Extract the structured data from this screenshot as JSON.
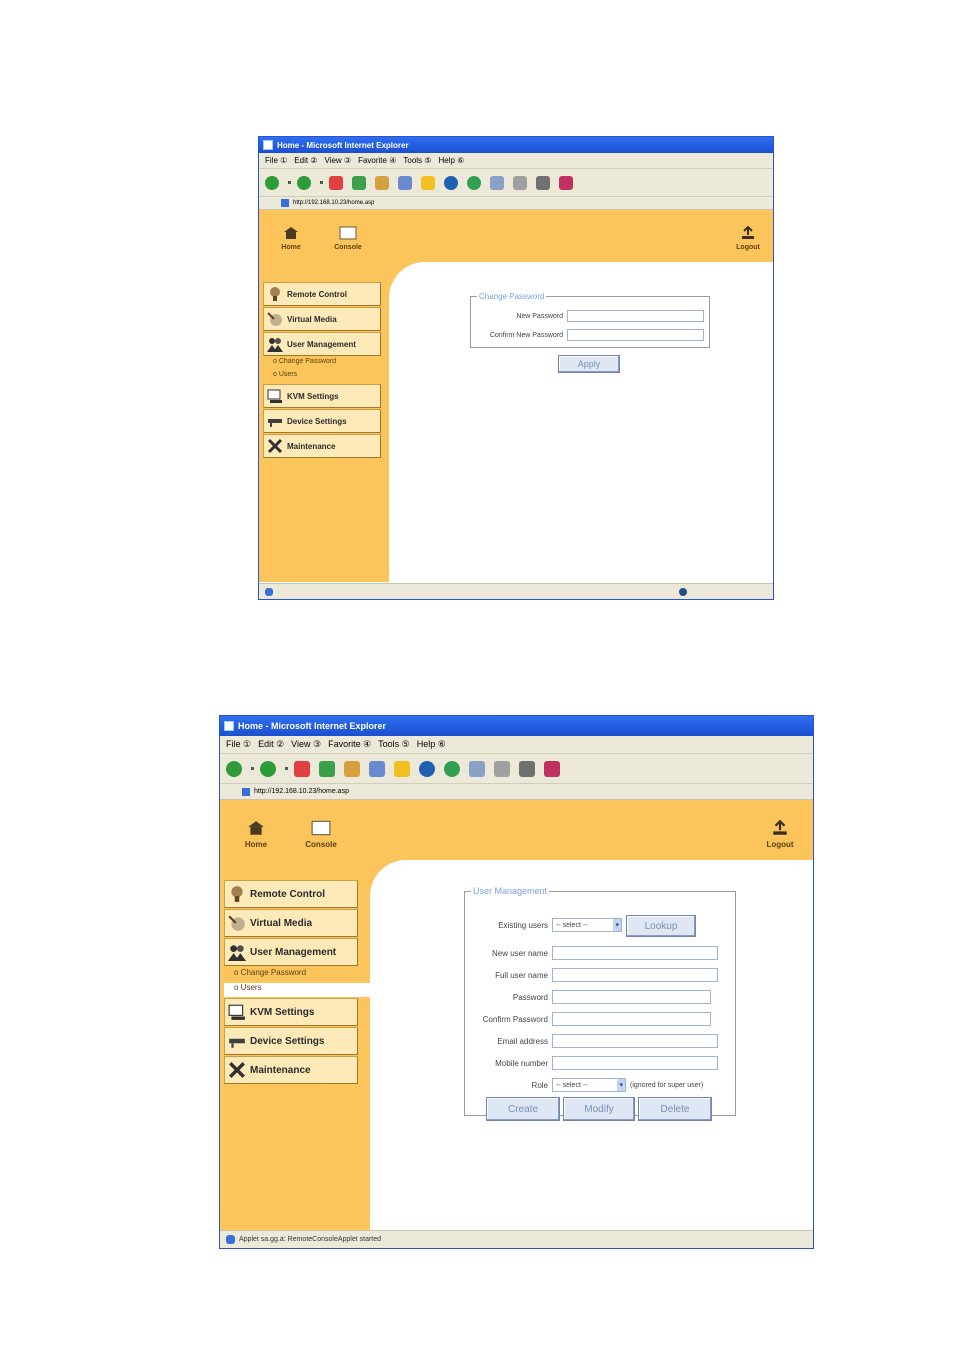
{
  "browser": {
    "title": "Home - Microsoft Internet Explorer",
    "menu": [
      "File ①",
      "Edit ②",
      "View ③",
      "Favorite ④",
      "Tools ⑤",
      "Help ⑥"
    ],
    "address": "http://192.168.10.23/home.asp",
    "status_bottom": "Applet sa.gg.a: RemoteConsoleApplet started"
  },
  "nav": {
    "home_label": "Home",
    "console_label": "Console",
    "logout_label": "Logout"
  },
  "sidebar": {
    "items": [
      {
        "label": "Remote Control"
      },
      {
        "label": "Virtual Media"
      },
      {
        "label": "User Management"
      },
      {
        "label": "KVM Settings"
      },
      {
        "label": "Device Settings"
      },
      {
        "label": "Maintenance"
      }
    ],
    "subitems": [
      "Change Password",
      "Users"
    ]
  },
  "change_password": {
    "legend": "Change Password",
    "new_password_label": "New Password",
    "confirm_password_label": "Confirm New Password",
    "apply_label": "Apply"
  },
  "user_management": {
    "legend": "User Management",
    "existing_users_label": "Existing users",
    "select_placeholder": "-- select --",
    "lookup_label": "Lookup",
    "new_user_name_label": "New user name",
    "full_user_name_label": "Full user name",
    "password_label": "Password",
    "confirm_password_label": "Confirm Password",
    "email_label": "Email address",
    "mobile_label": "Mobile number",
    "role_label": "Role",
    "role_select": "-- select --",
    "role_note": "(ignored for super user)",
    "create_label": "Create",
    "modify_label": "Modify",
    "delete_label": "Delete"
  },
  "colors": {
    "sidebar_bg": "#fcc55c",
    "button_bg": "#fdeab8",
    "legend_text": "#7aa3e0",
    "titlebar": "#1b4fd0"
  }
}
